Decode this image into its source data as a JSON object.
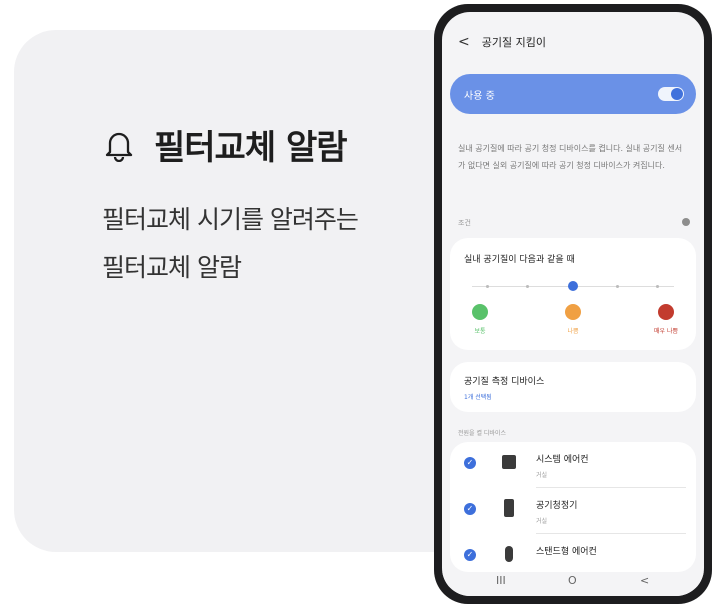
{
  "feature": {
    "title": "필터교체 알람",
    "desc_line1": "필터교체 시기를 알려주는",
    "desc_line2": "필터교체 알람"
  },
  "phone": {
    "header": {
      "back_icon": "back-chevron-icon",
      "title": "공기질 지킴이"
    },
    "toggle": {
      "label": "사용 중",
      "state": "on"
    },
    "description": "실내 공기질에 따라 공기 청정 디바이스를 켭니다. 실내 공기질 센서가 없다면 실외 공기질에 따라 공기 청정 디바이스가 켜집니다.",
    "condition": {
      "section_label": "조건",
      "info_icon": "info-icon"
    },
    "air_card": {
      "title": "실내 공기질이 다음과 같을 때",
      "selected_level_index": 1,
      "levels": [
        {
          "label": "보통",
          "color": "#59c26a"
        },
        {
          "label": "나쁨",
          "color": "#f0a043"
        },
        {
          "label": "매우 나쁨",
          "color": "#c23b2e"
        }
      ]
    },
    "measure_card": {
      "title": "공기질 측정 디바이스",
      "subtitle": "1개 선택됨"
    },
    "devices_section": "전원을 켤 디바이스",
    "devices": [
      {
        "name": "시스템 에어컨",
        "room": "거실"
      },
      {
        "name": "공기청정기",
        "room": "거실"
      },
      {
        "name": "스탠드형 에어컨",
        "room": ""
      }
    ],
    "nav": {
      "recent": "III",
      "home": "O",
      "back": "<"
    }
  },
  "colors": {
    "accent": "#3d6fdb",
    "toggle_bg": "#6a91e7",
    "card_bg": "#f1f1f3"
  }
}
